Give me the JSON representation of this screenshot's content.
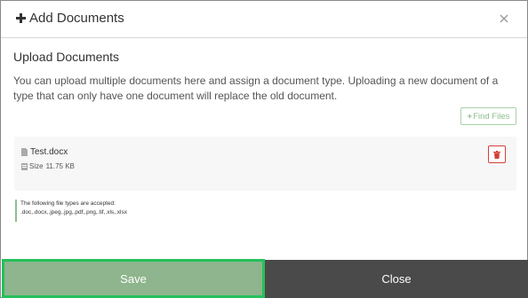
{
  "header": {
    "title": "Add Documents",
    "plus_icon": "plus-icon",
    "close_icon": "close-icon"
  },
  "upload": {
    "section_title": "Upload Documents",
    "description": "You can upload multiple documents here and assign a document type. Uploading a new document of a type that can only have one document will replace the old document.",
    "find_files_label": "Find Files"
  },
  "file": {
    "name": "Test.docx",
    "size_label": "Size",
    "size_value": "11.75 KB",
    "delete_icon": "trash-icon"
  },
  "accepted_types": {
    "heading": "The following file types are accepted:",
    "list": ".doc,.docx,.jpeg,.jpg,.pdf,.png,.tif,.xls,.xlsx"
  },
  "footer": {
    "save_label": "Save",
    "close_label": "Close"
  },
  "colors": {
    "save_bg": "#8eb58d",
    "save_focus_border": "#25c05a",
    "close_bg": "#4a4a4a",
    "delete_accent": "#d43f3a",
    "find_accent": "#8fbf8f"
  }
}
